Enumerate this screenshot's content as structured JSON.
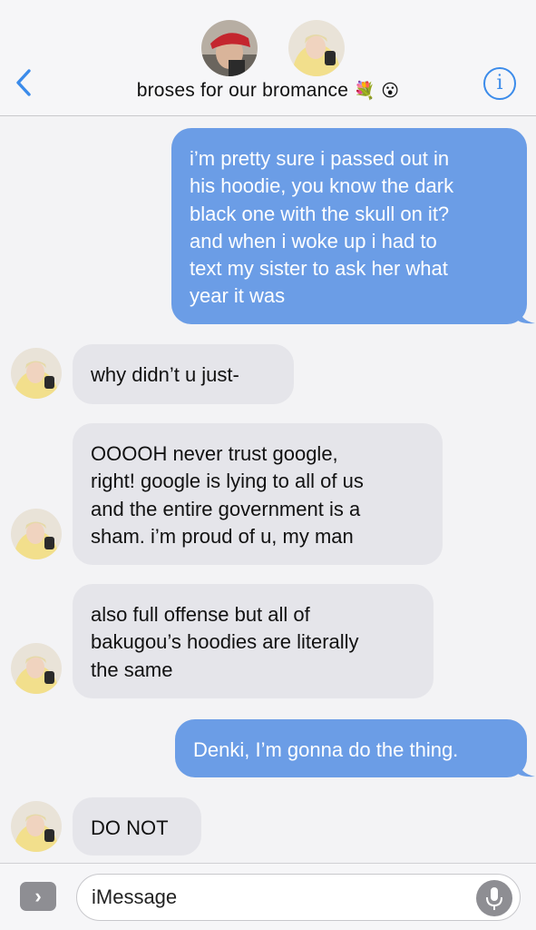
{
  "header": {
    "back_icon": "chevron-left-icon",
    "title": "broses for our bromance",
    "title_emojis": "💐 😮",
    "info_label": "i",
    "participants": [
      "participant-red-cap",
      "participant-yellow-hoodie"
    ]
  },
  "messages": [
    {
      "direction": "out",
      "lines": [
        "i’m pretty sure i passed out in",
        "his hoodie, you know the dark",
        "black one with the skull on it?",
        "and when i woke up i had to",
        "text my sister to ask her what",
        "year it was"
      ]
    },
    {
      "direction": "in",
      "lines": [
        "why didn’t u just-"
      ]
    },
    {
      "direction": "in",
      "lines": [
        "OOOOH never trust google,",
        "right! google is lying to all of us",
        "and the entire government is a",
        "sham. i’m proud of u, my man"
      ]
    },
    {
      "direction": "in",
      "lines": [
        "also full offense but all of",
        "bakugou’s hoodies are literally",
        "the same"
      ]
    },
    {
      "direction": "out",
      "lines": [
        "Denki, I’m gonna do the thing."
      ]
    },
    {
      "direction": "in",
      "lines": [
        "DO NOT"
      ]
    }
  ],
  "composer": {
    "apps_label": "›",
    "placeholder": "iMessage",
    "mic_icon": "microphone-icon"
  },
  "colors": {
    "outgoing_bubble": "#6b9de6",
    "incoming_bubble": "#e5e5ea",
    "accent": "#3b8bea"
  }
}
